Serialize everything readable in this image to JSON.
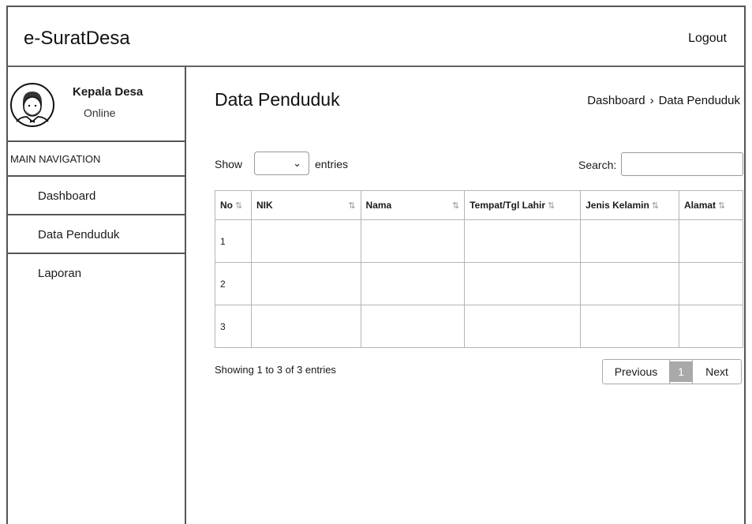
{
  "header": {
    "app_title": "e-SuratDesa",
    "logout_label": "Logout"
  },
  "sidebar": {
    "user_name": "Kepala Desa",
    "user_status": "Online",
    "nav_header": "MAIN NAVIGATION",
    "items": [
      {
        "label": "Dashboard"
      },
      {
        "label": "Data Penduduk"
      },
      {
        "label": "Laporan"
      }
    ]
  },
  "main": {
    "page_title": "Data Penduduk",
    "breadcrumb": [
      "Dashboard",
      "Data Penduduk"
    ],
    "breadcrumb_sep": "›",
    "show_label": "Show",
    "entries_label": "entries",
    "entries_value": "",
    "search_label": "Search:",
    "search_value": "",
    "table": {
      "columns": [
        "No",
        "NIK",
        "Nama",
        "Tempat/Tgl Lahir",
        "Jenis Kelamin",
        "Alamat"
      ],
      "rows": [
        [
          "1",
          "",
          "",
          "",
          "",
          ""
        ],
        [
          "2",
          "",
          "",
          "",
          "",
          ""
        ],
        [
          "3",
          "",
          "",
          "",
          "",
          ""
        ]
      ]
    },
    "info_text": "Showing 1 to 3 of 3 entries",
    "pagination": {
      "previous": "Previous",
      "current": "1",
      "next": "Next"
    }
  }
}
